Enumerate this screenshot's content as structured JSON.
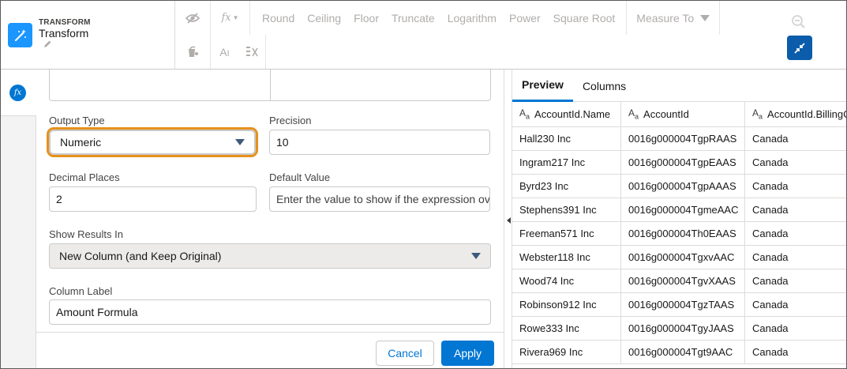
{
  "header": {
    "kicker": "TRANSFORM",
    "title": "Transform",
    "toolbar": [
      "Round",
      "Ceiling",
      "Floor",
      "Truncate",
      "Logarithm",
      "Power",
      "Square Root"
    ],
    "measure_to": "Measure To",
    "fx_label": "fx"
  },
  "rail": {
    "fx": "fx"
  },
  "form": {
    "output_type_label": "Output Type",
    "output_type_value": "Numeric",
    "precision_label": "Precision",
    "precision_value": "10",
    "decimal_places_label": "Decimal Places",
    "decimal_places_value": "2",
    "default_value_label": "Default Value",
    "default_value_placeholder": "Enter the value to show if the expression ov",
    "show_results_label": "Show Results In",
    "show_results_value": "New Column (and Keep Original)",
    "column_label_label": "Column Label",
    "column_label_value": "Amount Formula",
    "cancel": "Cancel",
    "apply": "Apply"
  },
  "preview": {
    "tabs": [
      "Preview",
      "Columns"
    ],
    "columns": [
      "AccountId.Name",
      "AccountId",
      "AccountId.BillingC"
    ],
    "rows": [
      [
        "Hall230 Inc",
        "0016g000004TgpRAAS",
        "Canada"
      ],
      [
        "Ingram217 Inc",
        "0016g000004TgpEAAS",
        "Canada"
      ],
      [
        "Byrd23 Inc",
        "0016g000004TgpAAAS",
        "Canada"
      ],
      [
        "Stephens391 Inc",
        "0016g000004TgmeAAC",
        "Canada"
      ],
      [
        "Freeman571 Inc",
        "0016g000004Th0EAAS",
        "Canada"
      ],
      [
        "Webster118 Inc",
        "0016g000004TgxvAAC",
        "Canada"
      ],
      [
        "Wood74 Inc",
        "0016g000004TgvXAAS",
        "Canada"
      ],
      [
        "Robinson912 Inc",
        "0016g000004TgzTAAS",
        "Canada"
      ],
      [
        "Rowe333 Inc",
        "0016g000004TgyJAAS",
        "Canada"
      ],
      [
        "Rivera969 Inc",
        "0016g000004Tgt9AAC",
        "Canada"
      ]
    ]
  },
  "icons": {
    "brand": "magic-wand-icon",
    "edit": "pencil-icon",
    "hide": "eye-slash-icon",
    "formula": "fx-dropdown-icon",
    "zoom": "zoom-out-icon",
    "collapse": "collapse-icon"
  },
  "colors": {
    "accent": "#0176d3",
    "focus": "#e6911b",
    "brand_icon": "#1b96ff"
  }
}
